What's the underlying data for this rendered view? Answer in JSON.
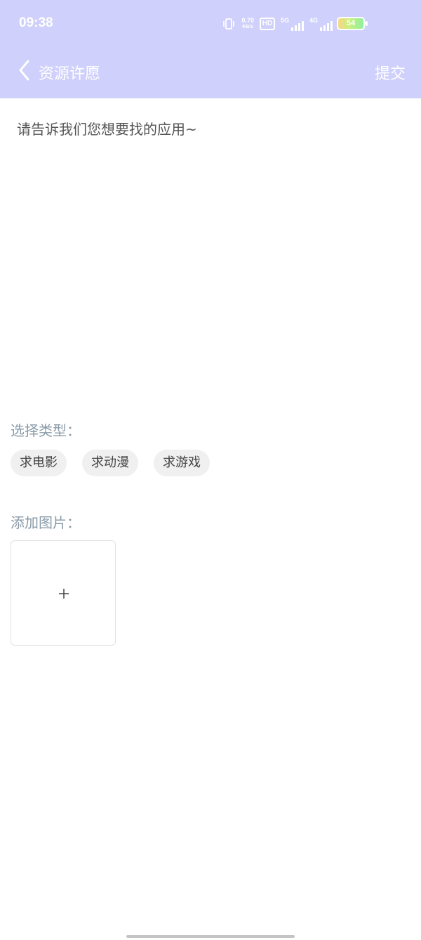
{
  "status_bar": {
    "time": "09:38",
    "net_speed_value": "0.70",
    "net_speed_unit": "KB/s",
    "hd_label": "HD",
    "signal_5g": "5G",
    "signal_4g": "4G",
    "battery": "54",
    "icons": [
      "vibrate-icon",
      "hd-icon",
      "signal-5g-icon",
      "signal-4g-icon",
      "wifi-icon",
      "charging-icon",
      "battery-icon"
    ]
  },
  "header": {
    "title": "资源许愿",
    "submit_label": "提交",
    "background_color": "#cfd0fb"
  },
  "form": {
    "description_placeholder": "请告诉我们您想要找的应用~",
    "description_value": "",
    "type_label": "选择类型：",
    "types": [
      "求电影",
      "求动漫",
      "求游戏"
    ],
    "image_label": "添加图片：",
    "add_image_icon": "plus-icon"
  }
}
